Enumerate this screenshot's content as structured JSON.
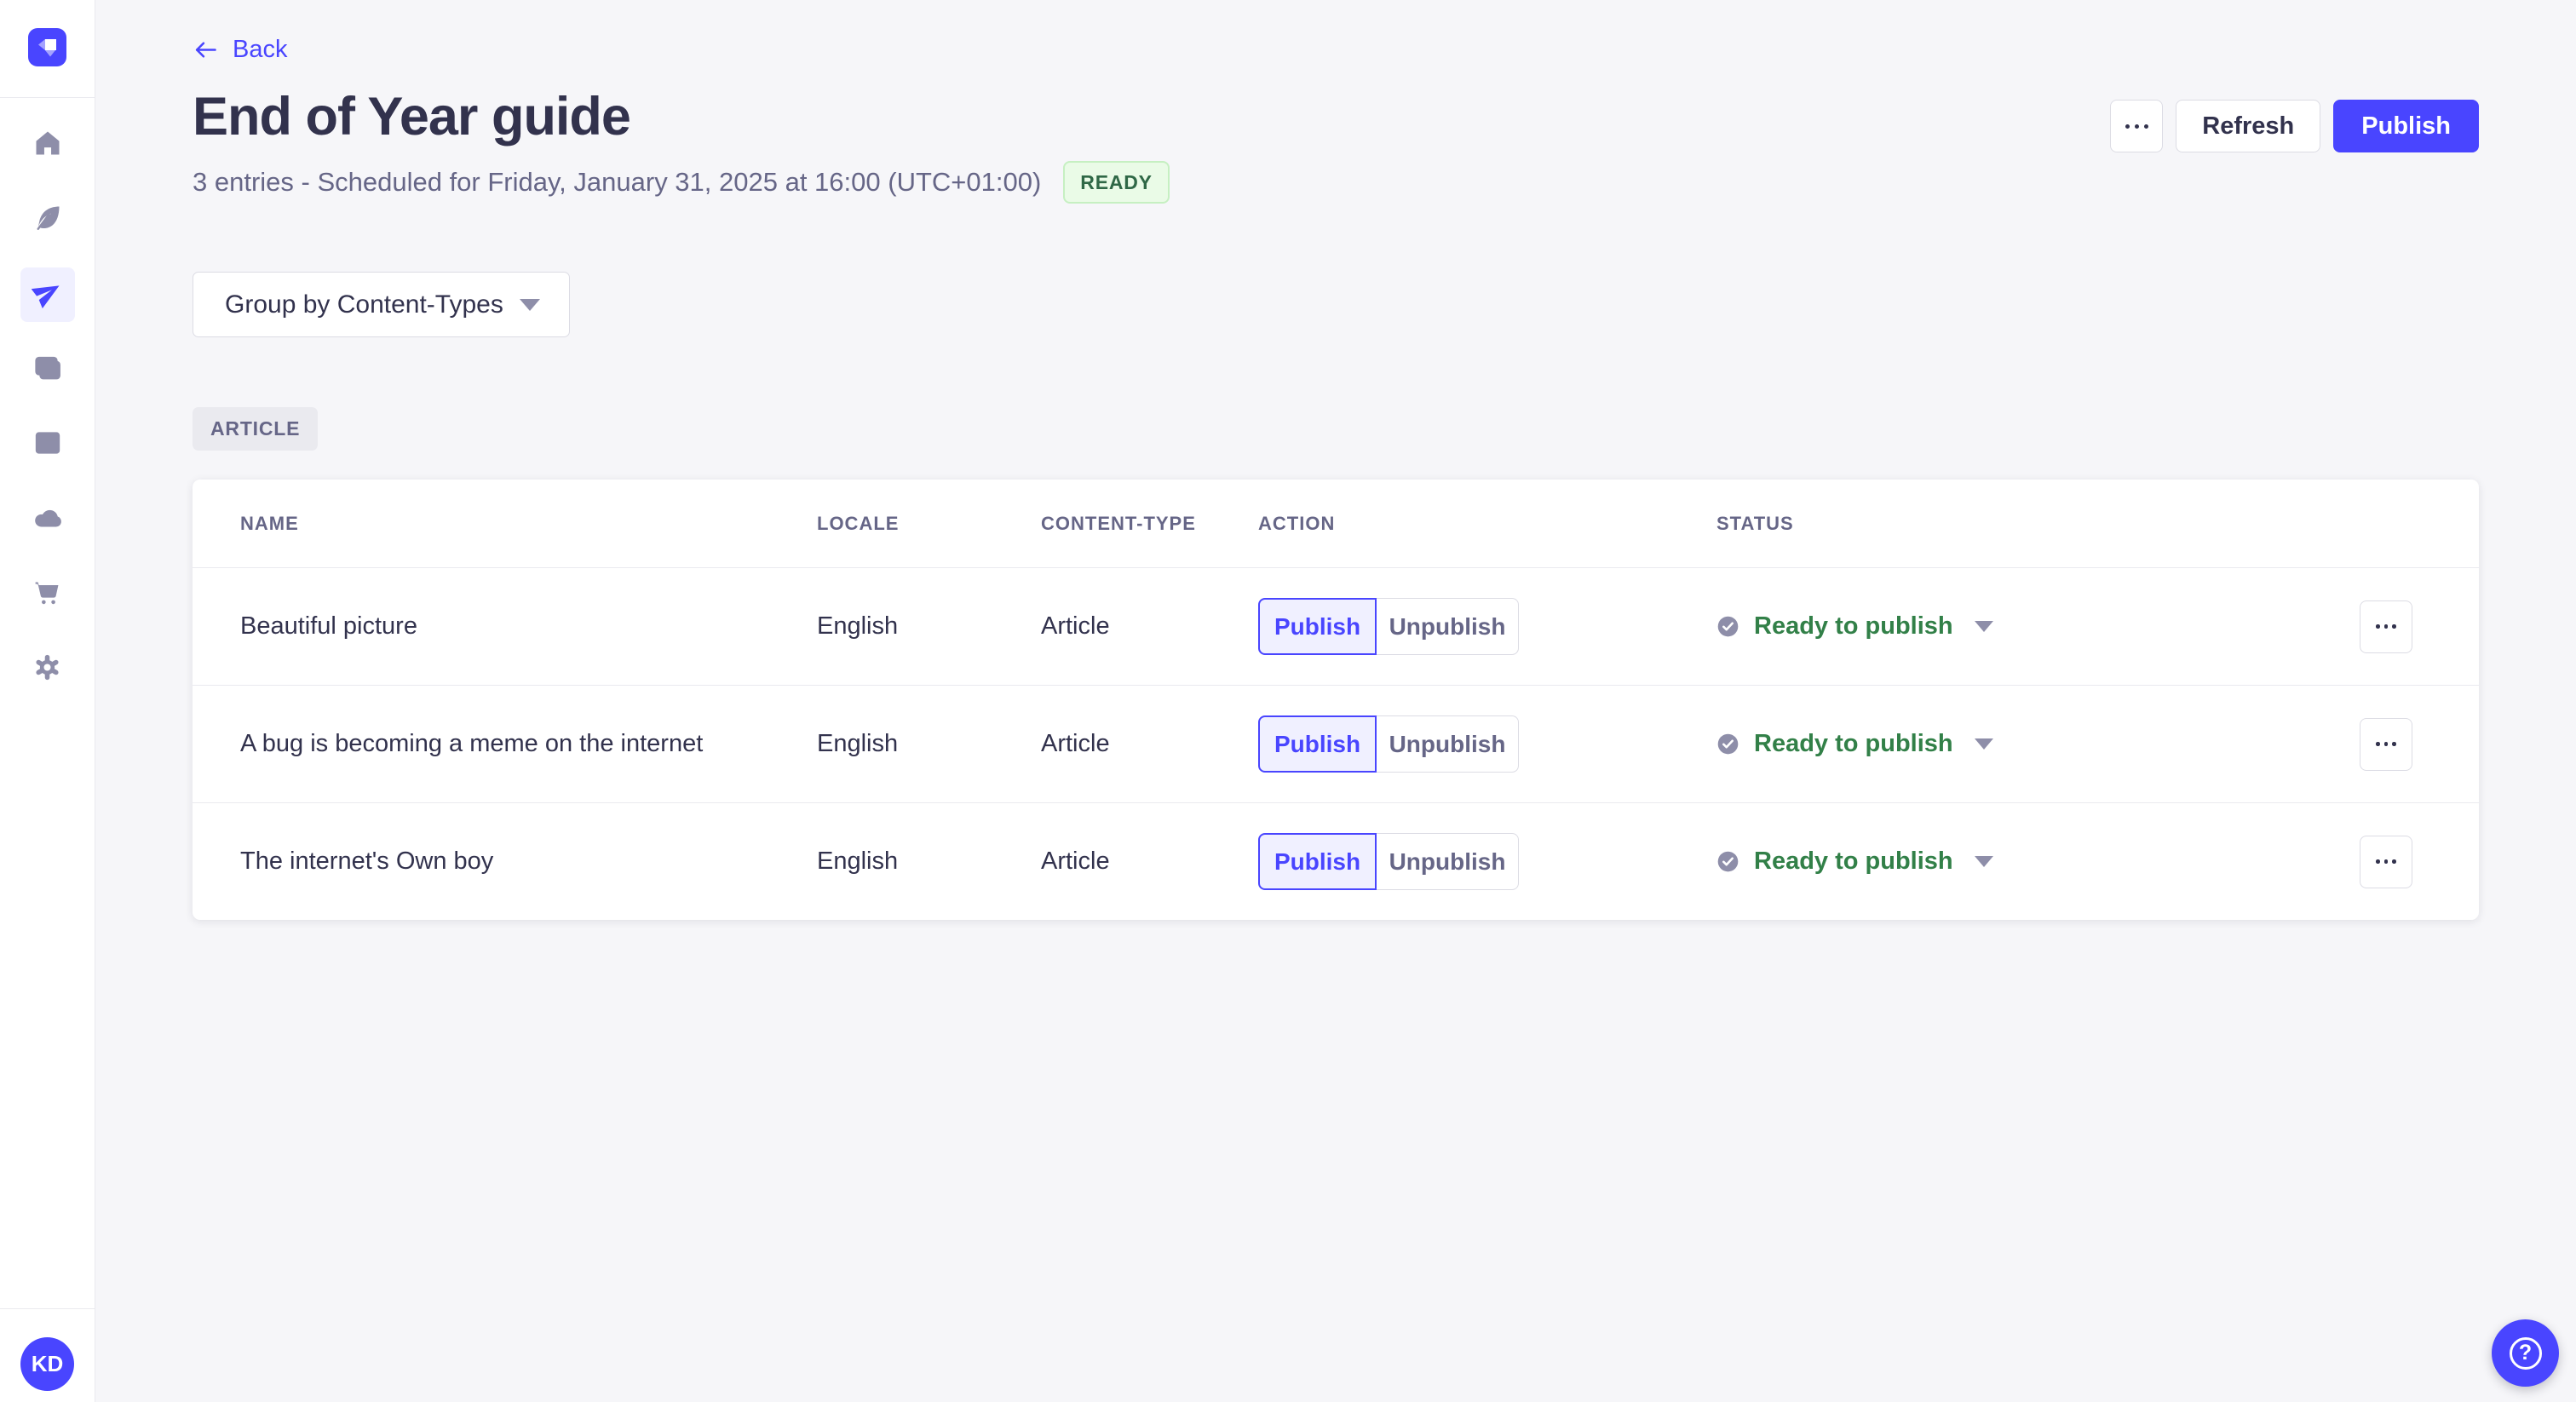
{
  "sidebar": {
    "logo_icon": "strapi-logo",
    "nav_items": [
      {
        "icon": "home-icon",
        "active": false
      },
      {
        "icon": "feather-icon",
        "active": false
      },
      {
        "icon": "paper-plane-icon",
        "active": true
      },
      {
        "icon": "media-library-icon",
        "active": false
      },
      {
        "icon": "layout-icon",
        "active": false
      },
      {
        "icon": "cloud-icon",
        "active": false
      },
      {
        "icon": "cart-icon",
        "active": false
      },
      {
        "icon": "gear-icon",
        "active": false
      }
    ],
    "avatar_initials": "KD"
  },
  "header": {
    "back_label": "Back",
    "title": "End of Year guide",
    "subtitle": "3 entries - Scheduled for Friday, January 31, 2025 at 16:00 (UTC+01:00)",
    "status_badge": "READY",
    "more_icon": "ellipsis-icon",
    "refresh_label": "Refresh",
    "publish_label": "Publish"
  },
  "filters": {
    "group_by_value": "Group by Content-Types"
  },
  "content_group": {
    "label": "ARTICLE"
  },
  "table": {
    "columns": [
      "NAME",
      "LOCALE",
      "CONTENT-TYPE",
      "ACTION",
      "STATUS"
    ],
    "rows": [
      {
        "name": "Beautiful picture",
        "locale": "English",
        "content_type": "Article",
        "publish_label": "Publish",
        "unpublish_label": "Unpublish",
        "status": "Ready to publish",
        "status_icon": "check-circle-icon"
      },
      {
        "name": "A bug is becoming a meme on the internet",
        "locale": "English",
        "content_type": "Article",
        "publish_label": "Publish",
        "unpublish_label": "Unpublish",
        "status": "Ready to publish",
        "status_icon": "check-circle-icon"
      },
      {
        "name": "The internet's Own boy",
        "locale": "English",
        "content_type": "Article",
        "publish_label": "Publish",
        "unpublish_label": "Unpublish",
        "status": "Ready to publish",
        "status_icon": "check-circle-icon"
      }
    ]
  },
  "fab": {
    "icon": "help-icon",
    "glyph": "?"
  },
  "colors": {
    "primary": "#4945FF",
    "primary_light": "#F0F0FF",
    "background": "#F6F6F9",
    "title_text": "#32324D",
    "neutral_text": "#666687",
    "icon_gray": "#8E8EA9",
    "border": "#DCDCE4",
    "separator": "#EAEAEF",
    "success_text": "#328048",
    "badge_bg": "#EAFBE7",
    "badge_border": "#C6F0C2",
    "badge_text": "#2F6846"
  }
}
